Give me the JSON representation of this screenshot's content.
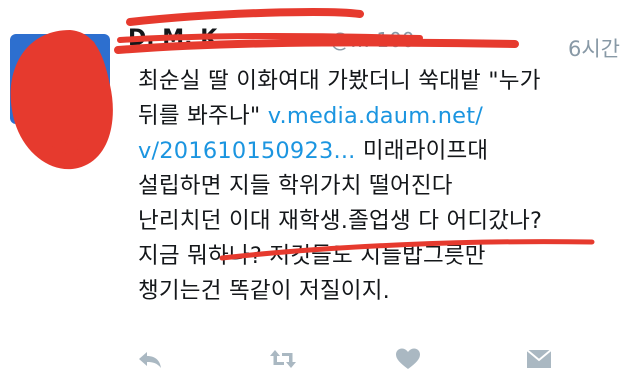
{
  "tweet": {
    "display_name": "D. M. K",
    "handle": "@… 100",
    "time": "6시간",
    "lines": [
      "최순실 딸 이화여대 가봤더니 쑥대밭 \"누가",
      "뒤를 봐주나\"",
      "v.media.daum.net/",
      "v/201610150923...",
      " 미래라이프대",
      "설립하면 지들 학위가치 떨어진다",
      "난리치던 이대 재학생.졸업생 다 어디갔나?",
      "지금 뭐하나? 저것들도 지들밥그릇만",
      "챙기는건 똑같이 저질이지."
    ]
  },
  "actions": {
    "reply_icon": "reply-icon",
    "retweet_icon": "retweet-icon",
    "like_icon": "heart-icon",
    "dm_icon": "envelope-icon"
  },
  "colors": {
    "link": "#1b95e0",
    "meta": "#8899a6",
    "icon": "#aab8c2",
    "scribble": "#e63a2e"
  }
}
